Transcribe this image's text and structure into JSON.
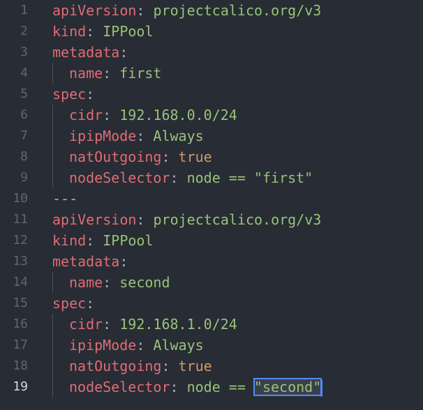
{
  "editor": {
    "lines": [
      {
        "num": "1",
        "key": "apiVersion",
        "colon": ":",
        "value": " projectcalico.org/v3",
        "vtype": "str",
        "indent": false
      },
      {
        "num": "2",
        "key": "kind",
        "colon": ":",
        "value": " IPPool",
        "vtype": "str",
        "indent": false
      },
      {
        "num": "3",
        "key": "metadata",
        "colon": ":",
        "value": "",
        "vtype": "str",
        "indent": false
      },
      {
        "num": "4",
        "key": "name",
        "colon": ":",
        "value": " first",
        "vtype": "str",
        "indent": true
      },
      {
        "num": "5",
        "key": "spec",
        "colon": ":",
        "value": "",
        "vtype": "str",
        "indent": false
      },
      {
        "num": "6",
        "key": "cidr",
        "colon": ":",
        "value": " 192.168.0.0/24",
        "vtype": "str",
        "indent": true
      },
      {
        "num": "7",
        "key": "ipipMode",
        "colon": ":",
        "value": " Always",
        "vtype": "str",
        "indent": true
      },
      {
        "num": "8",
        "key": "natOutgoing",
        "colon": ":",
        "value": " true",
        "vtype": "bool",
        "indent": true
      },
      {
        "num": "9",
        "key": "nodeSelector",
        "colon": ":",
        "value": " node == \"first\"",
        "vtype": "str",
        "indent": true
      },
      {
        "num": "10",
        "key": "",
        "colon": "",
        "value": "---",
        "vtype": "sep",
        "indent": false
      },
      {
        "num": "11",
        "key": "apiVersion",
        "colon": ":",
        "value": " projectcalico.org/v3",
        "vtype": "str",
        "indent": false
      },
      {
        "num": "12",
        "key": "kind",
        "colon": ":",
        "value": " IPPool",
        "vtype": "str",
        "indent": false
      },
      {
        "num": "13",
        "key": "metadata",
        "colon": ":",
        "value": "",
        "vtype": "str",
        "indent": false
      },
      {
        "num": "14",
        "key": "name",
        "colon": ":",
        "value": " second",
        "vtype": "str",
        "indent": true
      },
      {
        "num": "15",
        "key": "spec",
        "colon": ":",
        "value": "",
        "vtype": "str",
        "indent": false
      },
      {
        "num": "16",
        "key": "cidr",
        "colon": ":",
        "value": " 192.168.1.0/24",
        "vtype": "str",
        "indent": true
      },
      {
        "num": "17",
        "key": "ipipMode",
        "colon": ":",
        "value": " Always",
        "vtype": "str",
        "indent": true
      },
      {
        "num": "18",
        "key": "natOutgoing",
        "colon": ":",
        "value": " true",
        "vtype": "bool",
        "indent": true
      },
      {
        "num": "19",
        "key": "nodeSelector",
        "colon": ":",
        "value_prefix": " node == ",
        "value_selected": "\"second\"",
        "vtype": "str",
        "indent": true,
        "active": true
      }
    ]
  },
  "colors": {
    "background": "#282c34",
    "key": "#e06c75",
    "string": "#98c379",
    "boolean": "#d19a66",
    "line_number": "#5f6672",
    "line_number_active": "#d7dae0",
    "selection_border": "#528bff"
  }
}
